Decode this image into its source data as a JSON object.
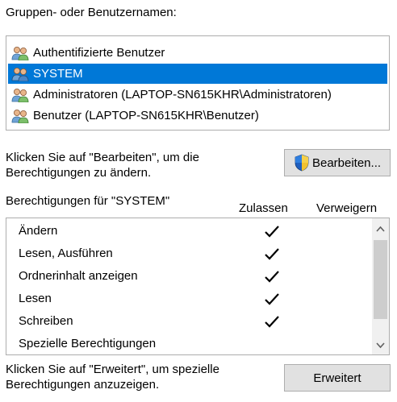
{
  "groups_label": "Gruppen- oder Benutzernamen:",
  "users": [
    {
      "name": "Authentifizierte Benutzer",
      "selected": false
    },
    {
      "name": "SYSTEM",
      "selected": true
    },
    {
      "name": "Administratoren (LAPTOP-SN615KHR\\Administratoren)",
      "selected": false
    },
    {
      "name": "Benutzer (LAPTOP-SN615KHR\\Benutzer)",
      "selected": false
    }
  ],
  "edit_hint": {
    "line1": "Klicken Sie auf \"Bearbeiten\", um die",
    "line2": "Berechtigungen zu ändern."
  },
  "edit_button": "Bearbeiten...",
  "permissions_header": {
    "title": "Berechtigungen für \"SYSTEM\"",
    "allow": "Zulassen",
    "deny": "Verweigern"
  },
  "permissions": [
    {
      "name": "Ändern",
      "allow": true,
      "deny": false
    },
    {
      "name": "Lesen, Ausführen",
      "allow": true,
      "deny": false
    },
    {
      "name": "Ordnerinhalt anzeigen",
      "allow": true,
      "deny": false
    },
    {
      "name": "Lesen",
      "allow": true,
      "deny": false
    },
    {
      "name": "Schreiben",
      "allow": true,
      "deny": false
    },
    {
      "name": "Spezielle Berechtigungen",
      "allow": false,
      "deny": false
    }
  ],
  "advanced_hint": {
    "line1": "Klicken Sie auf \"Erweitert\", um spezielle",
    "line2": "Berechtigungen anzuzeigen."
  },
  "advanced_button": "Erweitert",
  "colors": {
    "selection": "#0078d7",
    "button_bg": "#e1e1e1",
    "border": "#adadad"
  }
}
